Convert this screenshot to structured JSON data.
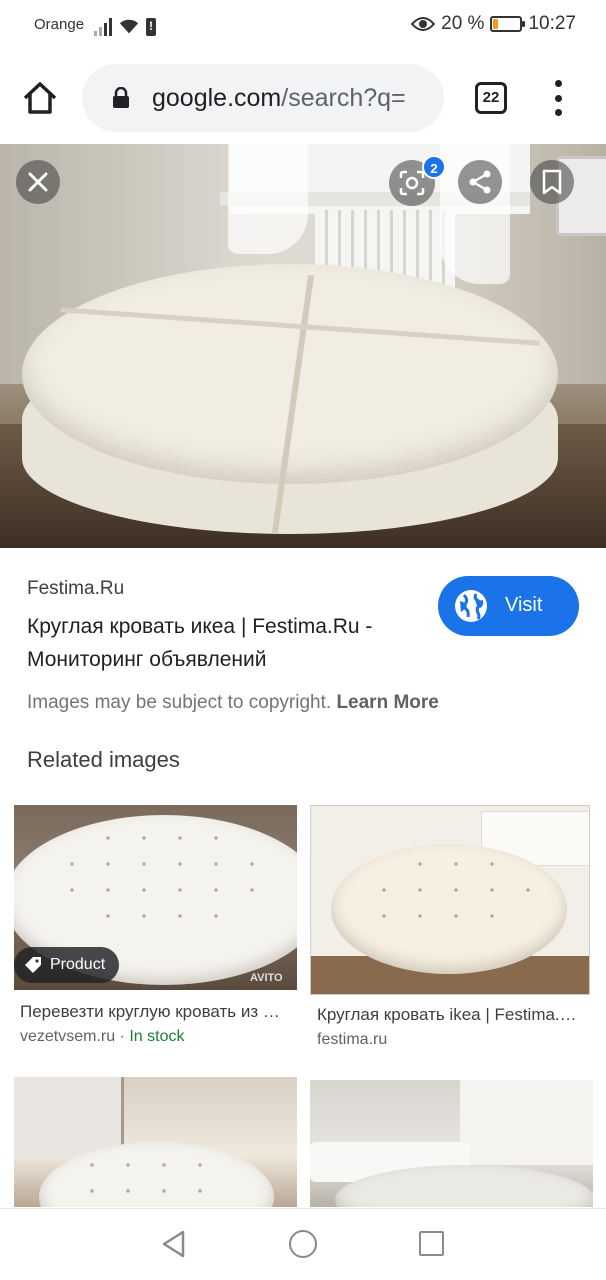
{
  "status_bar": {
    "carrier": "Orange",
    "battery_percent": "20 %",
    "battery_level": 0.2,
    "time": "10:27"
  },
  "browser": {
    "url_domain": "google.com",
    "url_path": "/search?q=",
    "tab_count": "22"
  },
  "viewer": {
    "lens_badge": "2",
    "source_name": "Festima.Ru",
    "title": "Круглая кровать икеа | Festima.Ru - Мониторинг объявлений",
    "visit_label": "Visit",
    "copyright_text": "Images may be subject to copyright.",
    "learn_more": "Learn More"
  },
  "related": {
    "heading": "Related images",
    "items": [
      {
        "chip": "Product",
        "watermark": "AVITO",
        "title": "Перевезти круглую кровать из Икеа",
        "source": "vezetvsem.ru",
        "separator": " · ",
        "stock": "In stock"
      },
      {
        "title": "Круглая кровать ikea | Festima.Ru",
        "source": "festima.ru"
      },
      {},
      {}
    ]
  },
  "icons": {
    "home": "home-icon",
    "lock": "lock-icon",
    "menu": "more-vert-icon",
    "close": "close-icon",
    "lens": "lens-icon",
    "share": "share-icon",
    "bookmark": "bookmark-icon",
    "globe": "globe-icon",
    "tag": "tag-icon"
  },
  "colors": {
    "accent": "#1a73e8",
    "stock_green": "#188038",
    "battery_low": "#f29b1d"
  }
}
